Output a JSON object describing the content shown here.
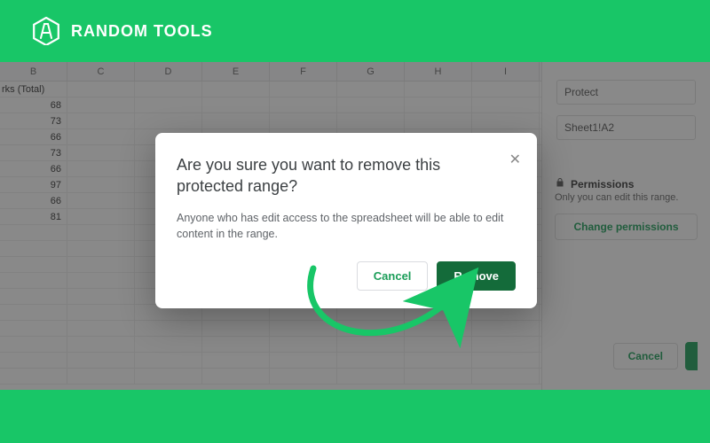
{
  "brand": {
    "name": "RANDOM TOOLS"
  },
  "sheet": {
    "columns": [
      "B",
      "C",
      "D",
      "E",
      "F",
      "G",
      "H",
      "I"
    ],
    "row_header_partial": "rks (Total)",
    "values": [
      68,
      73,
      66,
      73,
      66,
      97,
      66,
      81
    ]
  },
  "panel": {
    "protect_label": "Protect",
    "range_value": "Sheet1!A2",
    "permissions_title": "Permissions",
    "permissions_sub": "Only you can edit this range.",
    "change_btn": "Change permissions",
    "cancel_btn": "Cancel"
  },
  "modal": {
    "title": "Are you sure you want to remove this protected range?",
    "body": "Anyone who has edit access to the spreadsheet will be able to edit content in the range.",
    "cancel": "Cancel",
    "remove": "Remove"
  }
}
